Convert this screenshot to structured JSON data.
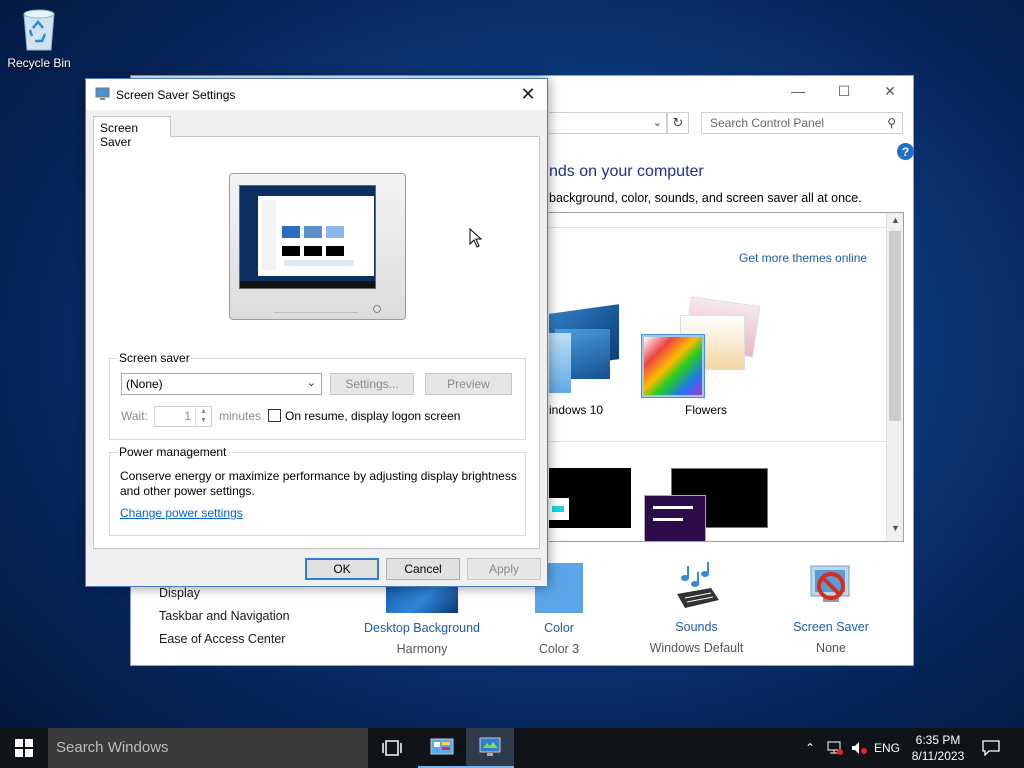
{
  "desktop": {
    "recycle_bin_label": "Recycle Bin"
  },
  "control_panel": {
    "search_placeholder": "Search Control Panel",
    "heading": "nds on your computer",
    "subheading": "background, color, sounds, and screen saver all at once.",
    "get_more_themes": "Get more themes online",
    "themes": [
      "indows 10",
      "Flowers"
    ],
    "left_links": [
      "Display",
      "Taskbar and Navigation",
      "Ease of Access Center"
    ],
    "options": [
      {
        "title": "Desktop Background",
        "value": "Harmony"
      },
      {
        "title": "Color",
        "value": "Color 3"
      },
      {
        "title": "Sounds",
        "value": "Windows Default"
      },
      {
        "title": "Screen Saver",
        "value": "None"
      }
    ]
  },
  "dialog": {
    "title": "Screen Saver Settings",
    "tab": "Screen Saver",
    "screen_saver_group": "Screen saver",
    "selected_saver": "(None)",
    "settings_button": "Settings...",
    "preview_button": "Preview",
    "wait_label": "Wait:",
    "wait_value": "1",
    "minutes_label": "minutes",
    "resume_checkbox_label": "On resume, display logon screen",
    "resume_checked": false,
    "power_group": "Power management",
    "power_text": "Conserve energy or maximize performance by adjusting display brightness and other power settings.",
    "power_link": "Change power settings",
    "ok_button": "OK",
    "cancel_button": "Cancel",
    "apply_button": "Apply"
  },
  "taskbar": {
    "search_placeholder": "Search Windows",
    "language": "ENG",
    "time": "6:35 PM",
    "date": "8/11/2023"
  },
  "colors": {
    "accent": "#2f7bd6",
    "link": "#0a63c9",
    "taskbar": "#101318"
  }
}
